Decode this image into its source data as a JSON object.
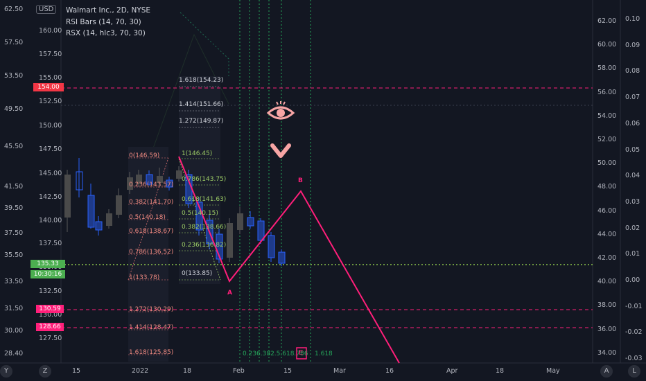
{
  "header": {
    "currency": "USD",
    "title": "Walmart Inc., 2D, NYSE",
    "indicator_1": "RSI Bars (14, 70, 30)",
    "indicator_2": "RSX (14, hlc3, 70, 30)"
  },
  "left_axis": [
    "62.50",
    "57.50",
    "53.50",
    "49.50",
    "45.50",
    "41.50",
    "39.50",
    "37.50",
    "35.50",
    "33.50",
    "31.50",
    "30.00",
    "28.40"
  ],
  "price_axis": [
    "160.00",
    "157.50",
    "155.00",
    "152.50",
    "150.00",
    "147.50",
    "145.00",
    "142.50",
    "140.00",
    "137.50",
    "135.00",
    "132.50",
    "130.00",
    "127.50"
  ],
  "right_axis_a": [
    "62.00",
    "60.00",
    "58.00",
    "56.00",
    "54.00",
    "52.00",
    "50.00",
    "48.00",
    "46.00",
    "44.00",
    "42.00",
    "40.00",
    "38.00",
    "36.00",
    "34.00"
  ],
  "right_axis_b": [
    "0.10",
    "0.09",
    "0.08",
    "0.07",
    "0.06",
    "0.05",
    "0.04",
    "0.03",
    "0.02",
    "0.01",
    "0.00",
    "-0.01",
    "-0.02",
    "-0.03"
  ],
  "price_tags": {
    "tag_154": "154.00",
    "current_price": "135.33",
    "countdown": "10:30:16",
    "tag_130": "130.59",
    "tag_128": "128.66"
  },
  "fib_left": [
    "0(146.59)",
    "0.236(143.57)",
    "0.382(141.70)",
    "0.5(140.18)",
    "0.618(138.67)",
    "0.786(136.52)",
    "1(133.78)",
    "1.272(130.29)",
    "1.414(128.47)",
    "1.618(125.85)"
  ],
  "fib_middle_ext": [
    "1.618(154.23)",
    "1.414(151.66)",
    "1.272(149.87)"
  ],
  "fib_middle": [
    "1(146.45)",
    "0.786(143.75)",
    "0.618(141.63)",
    "0.5(140.15)",
    "0.382(138.66)",
    "0.236(136.82)",
    "0(133.85)"
  ],
  "pattern_labels": {
    "a": "A",
    "b": "B",
    "e": "E",
    "fib_1618": "1.618",
    "bottom_fibs": "0.236.382.5.618.786"
  },
  "time_axis": [
    "15",
    "2022",
    "18",
    "Feb",
    "15",
    "Mar",
    "16",
    "Apr",
    "18",
    "May"
  ],
  "bottom_buttons": {
    "left_y": "Y",
    "left_z": "Z",
    "right_a": "A",
    "right_l": "L"
  },
  "colors": {
    "up": "#4a4a4a",
    "down": "#2962ff",
    "pink": "#ff1f7a",
    "green": "#26a65b",
    "fib_red": "#f28b82",
    "fib_green": "#9ccc65"
  }
}
